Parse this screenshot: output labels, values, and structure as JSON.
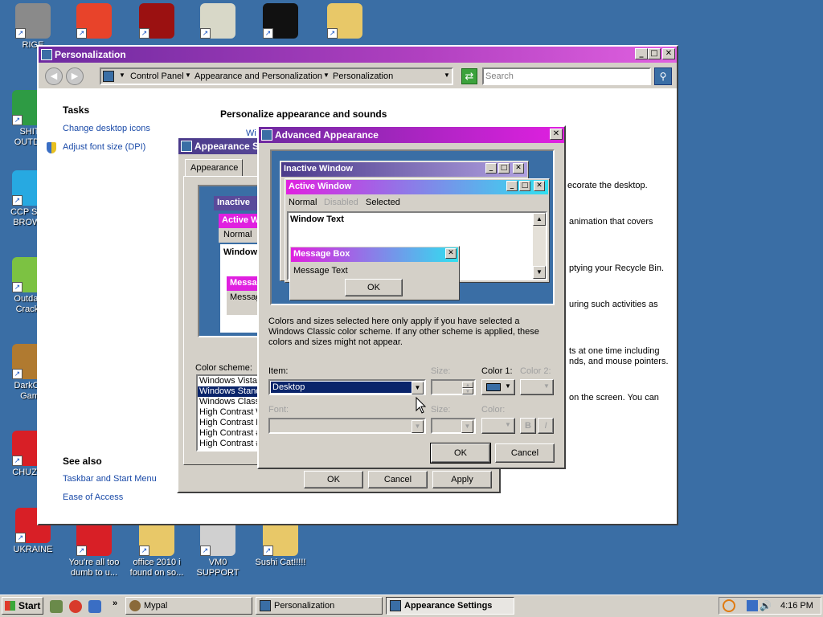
{
  "desktop_icons": [
    {
      "label": "RIGE",
      "icon": "raccoon-icon",
      "color": "#8a8a8a"
    },
    {
      "label": "",
      "icon": "p-app-icon",
      "color": "#e8432a"
    },
    {
      "label": "",
      "icon": "flash-icon",
      "color": "#9b1111"
    },
    {
      "label": "",
      "icon": "hxd-icon",
      "color": "#d8d8c8"
    },
    {
      "label": "",
      "icon": "console-icon",
      "color": "#111111"
    },
    {
      "label": "",
      "icon": "folder-icon",
      "color": "#e8c868"
    },
    {
      "label": "SHIT\nOUTDA",
      "icon": "chrome-icon",
      "color": "#2e9b44"
    },
    {
      "label": "CCP SPY\nBROWS",
      "icon": "pinwheel-icon",
      "color": "#27a9e1"
    },
    {
      "label": "Outdate\nCrack I",
      "icon": "bubbles-icon",
      "color": "#7cc242"
    },
    {
      "label": "DarkOK\nGam",
      "icon": "money-bag-icon",
      "color": "#b07a30"
    },
    {
      "label": "CHUZZL",
      "icon": "chuzzle-icon",
      "color": "#d81f26"
    },
    {
      "label": "UKRAINE",
      "icon": "ukraine-icon",
      "color": "#d81f26"
    },
    {
      "label": "You're all too\ndumb to u...",
      "icon": "plus-plus-icon",
      "color": "#d81f26"
    },
    {
      "label": "office 2010 i\nfound on so...",
      "icon": "office-folder-icon",
      "color": "#e8c868"
    },
    {
      "label": "VM0 SUPPORT",
      "icon": "support-icon",
      "color": "#d0d0d0"
    },
    {
      "label": "Sushi Cat!!!!!",
      "icon": "sushi-folder-icon",
      "color": "#e8c868"
    }
  ],
  "personalization": {
    "title": "Personalization",
    "breadcrumb": [
      "Control Panel",
      "Appearance and Personalization",
      "Personalization"
    ],
    "search_placeholder": "Search",
    "tasks_heading": "Tasks",
    "tasks": [
      "Change desktop icons",
      "Adjust font size (DPI)"
    ],
    "main_heading": "Personalize appearance and sounds",
    "partial_texts": [
      "ecorate the desktop.",
      "animation that covers",
      "ptying your Recycle Bin.",
      "uring such activities as",
      "ts at one time including",
      "nds, and mouse pointers.",
      "on the screen. You can"
    ],
    "wi_stub": "Wi",
    "see_also_heading": "See also",
    "see_also": [
      "Taskbar and Start Menu",
      "Ease of Access"
    ]
  },
  "appearance_settings": {
    "title": "Appearance Se",
    "tab": "Appearance",
    "preview_inactive": "Inactive",
    "preview_active": "Active W",
    "preview_normal": "Normal",
    "preview_window": "Window",
    "preview_msg": "Messag",
    "preview_msg2": "Messag",
    "color_scheme_label": "Color scheme:",
    "schemes": [
      "Windows Vista B",
      "Windows Stand",
      "Windows Classi",
      "High Contrast W",
      "High Contrast B",
      "High Contrast #",
      "High Contrast #"
    ],
    "selected_scheme_index": 1,
    "ok": "OK",
    "cancel": "Cancel",
    "apply": "Apply"
  },
  "advanced_appearance": {
    "title": "Advanced Appearance",
    "inactive_window": "Inactive Window",
    "active_window": "Active Window",
    "menu_normal": "Normal",
    "menu_disabled": "Disabled",
    "menu_selected": "Selected",
    "window_text": "Window Text",
    "message_box": "Message Box",
    "message_text": "Message Text",
    "msg_ok": "OK",
    "info": "Colors and sizes selected here only apply if you have selected a Windows Classic color scheme. If any other scheme is applied, these colors and sizes might not appear.",
    "item_label": "Item:",
    "item_value": "Desktop",
    "size_label": "Size:",
    "color1_label": "Color 1:",
    "color2_label": "Color 2:",
    "font_label": "Font:",
    "font_size_label": "Size:",
    "font_color_label": "Color:",
    "bold": "B",
    "italic": "I",
    "ok": "OK",
    "cancel": "Cancel",
    "color1_value": "#3a6ea5"
  },
  "taskbar": {
    "start": "Start",
    "items": [
      "Mypal",
      "Personalization",
      "Appearance Settings"
    ],
    "active_index": 2,
    "clock": "4:16 PM"
  },
  "colors": {
    "desktop": "#3a6ea5",
    "title_active_start": "#7b1fa2",
    "title_active_end": "#e020e0",
    "title_inactive_start": "#4a3a8a",
    "title_inactive_end": "#9a8ad8",
    "title_cyan": "#30e0f0",
    "dialog_face": "#d4d0c8"
  }
}
